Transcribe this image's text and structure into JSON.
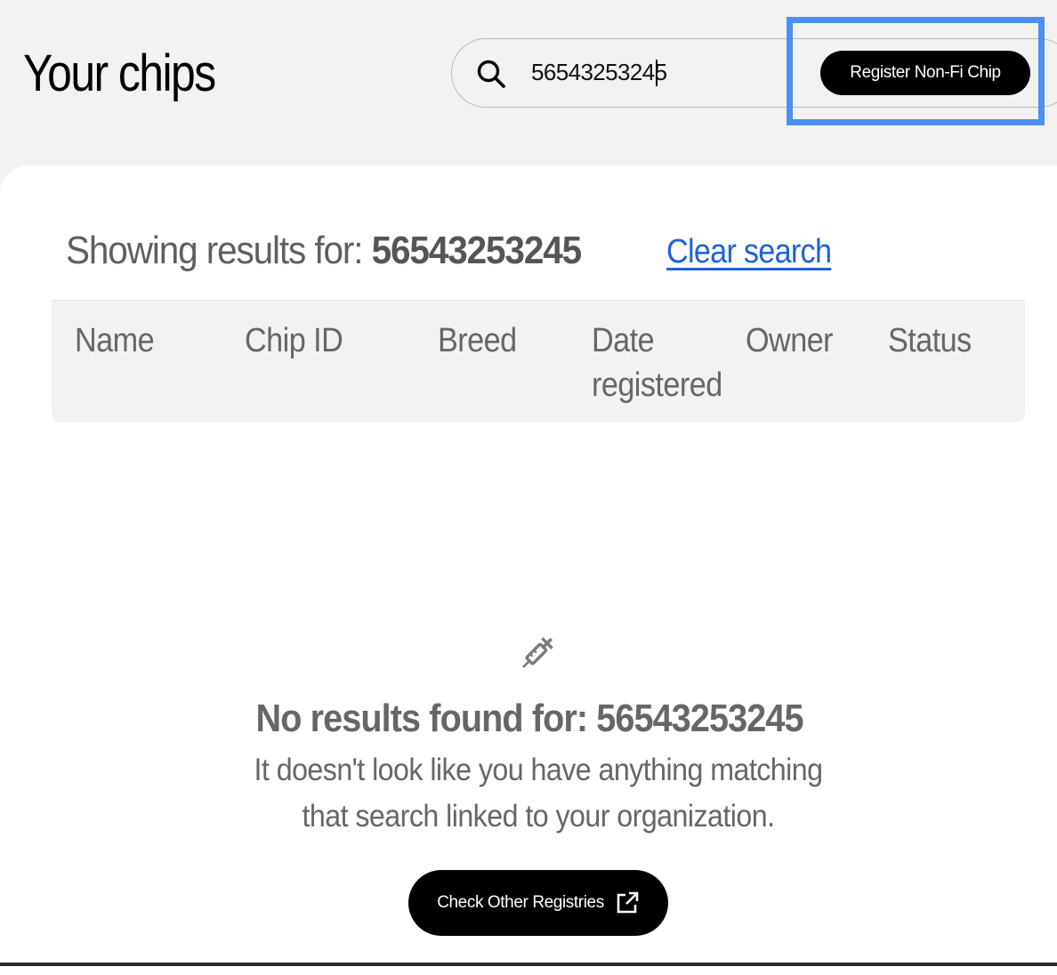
{
  "header": {
    "title": "Your chips",
    "search": {
      "value": "56543253245",
      "icon": "search-icon"
    },
    "register_button_label": "Register Non-Fi Chip",
    "highlight_color": "#4d8ff0"
  },
  "results": {
    "prefix": "Showing results for:",
    "query": "56543253245",
    "clear_label": "Clear search",
    "link_color": "#1f63d6"
  },
  "table": {
    "columns": [
      "Name",
      "Chip ID",
      "Breed",
      "Date\nregistered",
      "Owner",
      "Status"
    ],
    "rows": []
  },
  "empty_state": {
    "icon": "syringe-icon",
    "title": "No results found for: 56543253245",
    "message": "It doesn't look like you have anything matching that search linked to your organization.",
    "button_label": "Check Other Registries",
    "button_icon": "external-link-icon"
  }
}
